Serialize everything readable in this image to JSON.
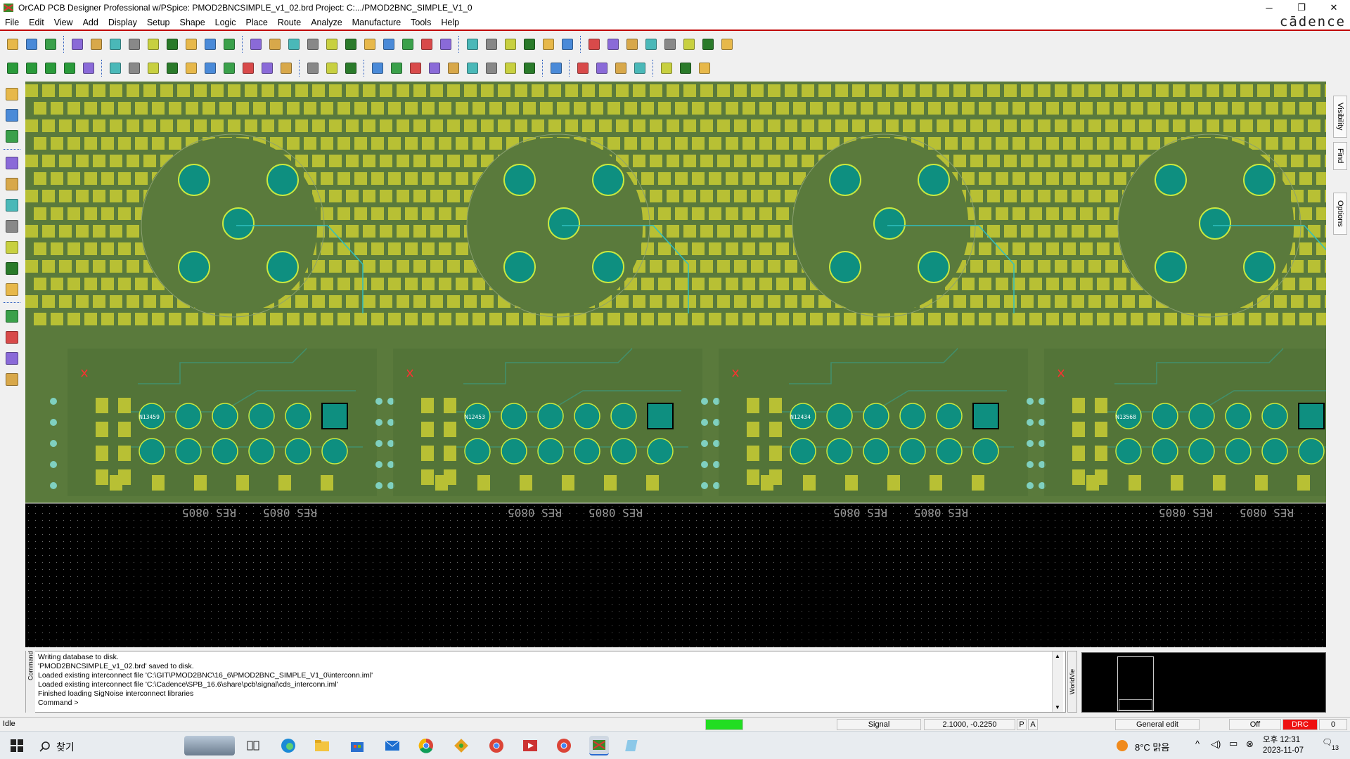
{
  "window": {
    "title": "OrCAD PCB Designer Professional w/PSpice: PMOD2BNCSIMPLE_v1_02.brd  Project: C:.../PMOD2BNC_SIMPLE_V1_0",
    "minimize": "─",
    "restore": "❐",
    "close": "✕"
  },
  "brand": "cādence",
  "menu": [
    "File",
    "Edit",
    "View",
    "Add",
    "Display",
    "Setup",
    "Shape",
    "Logic",
    "Place",
    "Route",
    "Analyze",
    "Manufacture",
    "Tools",
    "Help"
  ],
  "toolbar1_icons": [
    "new-icon",
    "open-icon",
    "save-icon",
    "sep",
    "move-icon",
    "copy-icon",
    "delete-icon",
    "undo-icon",
    "redo-down-icon",
    "redo-icon",
    "redo2-icon",
    "refresh-icon",
    "pin-icon",
    "sep",
    "grid-icon",
    "grid2-icon",
    "zoom-fit-icon",
    "zoom-in-icon",
    "zoom-in2-icon",
    "zoom-out-icon",
    "zoom-prev-icon",
    "zoom-world-icon",
    "redraw-icon",
    "3d-icon",
    "ipc-icon",
    "sep",
    "grid-toggle-icon",
    "color-icon",
    "layer-icon",
    "stack-icon",
    "dbdoctor-icon",
    "xsection-icon",
    "sep",
    "info-icon",
    "report-icon",
    "measure-icon",
    "rocket-icon",
    "sun-icon",
    "sun2-icon",
    "hourglass-icon",
    "tools-icon"
  ],
  "toolbar2_icons": [
    "layer-green1-icon",
    "layer-green2-icon",
    "layer-green3-icon",
    "layer-green4-icon",
    "layer-gray-icon",
    "sep",
    "shape-poly-icon",
    "shape-rect-icon",
    "shape-circle-icon",
    "shape-select-icon",
    "shape-edit-icon",
    "shape-merge-icon",
    "shape-void-icon",
    "shape-void2-icon",
    "shape-void3-icon",
    "shape-island-icon",
    "sep",
    "place-icon",
    "dim-icon",
    "dim2-icon",
    "sep",
    "swap-icon",
    "align-icon",
    "spread-icon",
    "snap-icon",
    "bom-icon",
    "flag-icon",
    "grid-place-icon",
    "glue-icon",
    "matrix-icon",
    "sep",
    "signal-icon",
    "sep",
    "doc1-icon",
    "doc2-icon",
    "doc3-icon",
    "doc4-icon",
    "sep",
    "window-icon",
    "mail-icon",
    "help-icon"
  ],
  "left_tools": [
    "add-connect-icon",
    "slide-icon",
    "via-icon",
    "sep",
    "fanout-icon",
    "delay-tune-icon",
    "phase-tune-icon",
    "route-icon",
    "custom-smooth-icon",
    "spread-lines-icon",
    "bus-icon",
    "sep",
    "add-line-icon",
    "add-rect-icon",
    "add-text-icon",
    "edit-text-icon"
  ],
  "right_tabs": [
    "Visibility",
    "Find",
    "Options"
  ],
  "silkscreen": [
    "RES 0805",
    "RES 0805",
    "RES 0805",
    "RES 0805",
    "RES 0805",
    "RES 0805",
    "RES 0805",
    "RES 0805"
  ],
  "net_labels": [
    "N13459",
    "N12453",
    "N12434",
    "N13568"
  ],
  "command": {
    "label": "Command",
    "lines": [
      "Writing database to disk.",
      "'PMOD2BNCSIMPLE_v1_02.brd' saved to disk.",
      "Loaded existing interconnect file 'C:\\GIT\\PMOD2BNC\\16_6\\PMOD2BNC_SIMPLE_V1_0\\interconn.iml'",
      "Loaded existing interconnect file 'C:\\Cadence\\SPB_16.6\\share\\pcb\\signal\\cds_interconn.iml'",
      "Finished loading SigNoise interconnect libraries",
      "Command >"
    ]
  },
  "worldview_label": "WorldVie",
  "status": {
    "state": "Idle",
    "layer": "Signal",
    "coords": "2.1000, -0.2250",
    "p": "P",
    "a": "A",
    "mode": "General edit",
    "off": "Off",
    "drc": "DRC",
    "count": "0",
    "busy_color": "#22dd22",
    "drc_color": "#ee1111"
  },
  "taskbar": {
    "search": "찾기",
    "weather": "8°C  맑음",
    "time": "오후 12:31",
    "date": "2023-11-07",
    "notifications": "13"
  },
  "colors": {
    "board": "#5a7a3c",
    "pad": "#b8c034",
    "trace": "#2fc0c0",
    "hole": "#0e8f80",
    "accent": "#c00000"
  }
}
